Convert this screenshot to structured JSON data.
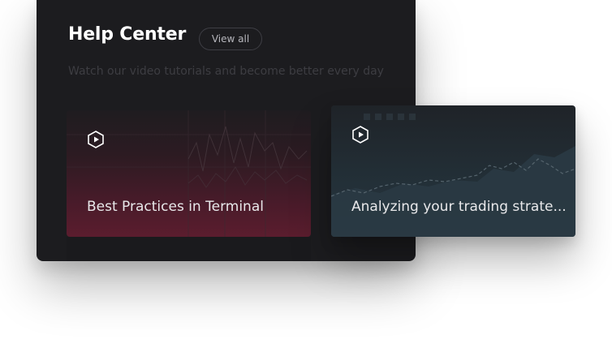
{
  "help_center": {
    "title": "Help Center",
    "view_all_label": "View all",
    "subtitle": "Watch our video tutorials and become better every day"
  },
  "cards": [
    {
      "label": "Best Practices in Terminal",
      "icon": "play-icon"
    },
    {
      "label": "Analyzing your trading strate...",
      "icon": "play-icon"
    }
  ],
  "colors": {
    "panel_bg": "#1c1c1f",
    "card1_accent": "#5b1d2e",
    "card2_accent": "#28353e",
    "text_primary": "#ffffff"
  }
}
